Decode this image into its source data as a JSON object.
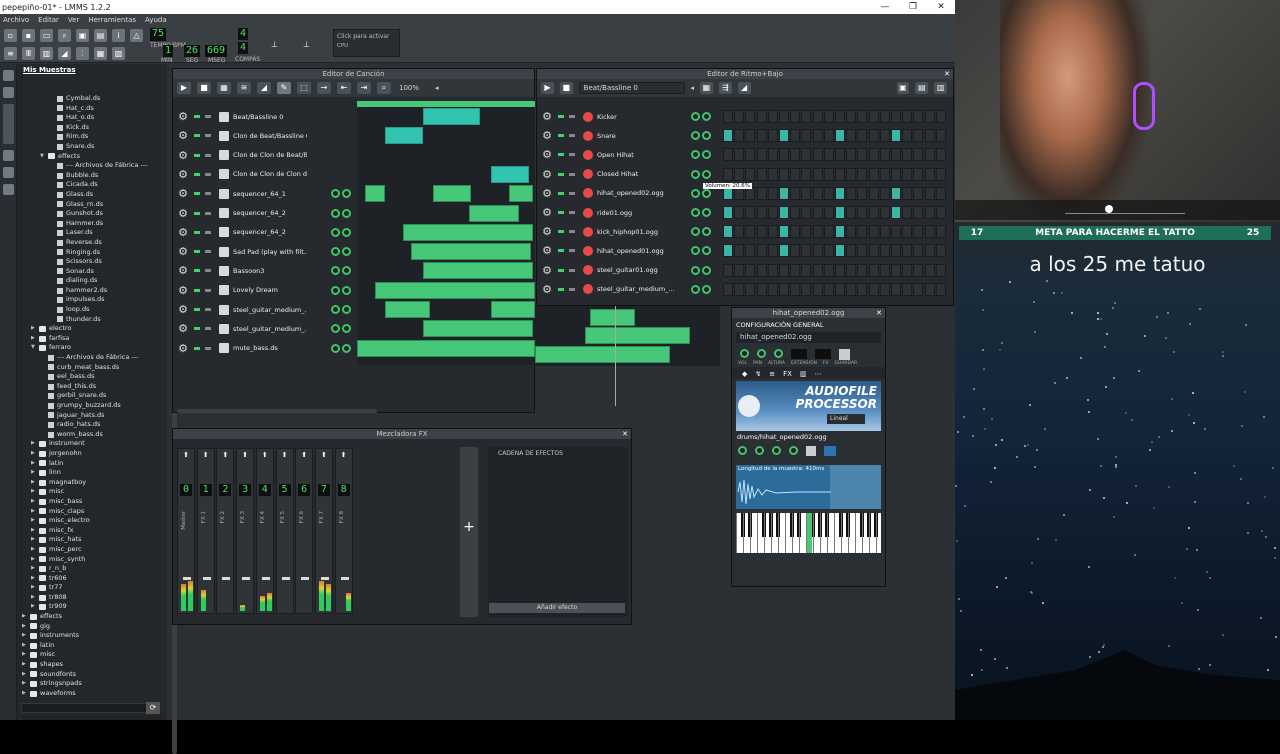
{
  "window": {
    "title": "pepepiño-01* - LMMS 1.2.2",
    "controls": [
      "—",
      "❐",
      "✕"
    ]
  },
  "menu": [
    "Archivo",
    "Editar",
    "Ver",
    "Herramientas",
    "Ayuda"
  ],
  "toolbar": {
    "tempo": "75",
    "tempo_label": "TEMPO/BPM",
    "time_min": "1",
    "time_sec": "26",
    "time_msec": "669",
    "time_labels": [
      "MIN",
      "SEG",
      "MSEG"
    ],
    "sig_top": "4",
    "sig_bottom": "4",
    "sig_label": "COMPÁS",
    "cpu_hint": "Click para activar",
    "cpu_label": "CPU"
  },
  "sidebar": {
    "title": "Mis Muestras",
    "items": [
      {
        "t": "Cymbal.ds",
        "k": "file",
        "d": 4
      },
      {
        "t": "Hat_c.ds",
        "k": "file",
        "d": 4
      },
      {
        "t": "Hat_o.ds",
        "k": "file",
        "d": 4
      },
      {
        "t": "Kick.ds",
        "k": "file",
        "d": 4
      },
      {
        "t": "Rim.ds",
        "k": "file",
        "d": 4
      },
      {
        "t": "Snare.ds",
        "k": "file",
        "d": 4
      },
      {
        "t": "effects",
        "k": "folder",
        "d": 3,
        "open": true
      },
      {
        "t": "--- Archivos de Fábrica ---",
        "k": "file",
        "d": 4
      },
      {
        "t": "Bubble.ds",
        "k": "file",
        "d": 4
      },
      {
        "t": "Cicada.ds",
        "k": "file",
        "d": 4
      },
      {
        "t": "Glass.ds",
        "k": "file",
        "d": 4
      },
      {
        "t": "Glass_rn.ds",
        "k": "file",
        "d": 4
      },
      {
        "t": "Gunshot.ds",
        "k": "file",
        "d": 4
      },
      {
        "t": "Hammer.ds",
        "k": "file",
        "d": 4
      },
      {
        "t": "Laser.ds",
        "k": "file",
        "d": 4
      },
      {
        "t": "Reverse.ds",
        "k": "file",
        "d": 4
      },
      {
        "t": "Ringing.ds",
        "k": "file",
        "d": 4
      },
      {
        "t": "Scissors.ds",
        "k": "file",
        "d": 4
      },
      {
        "t": "Sonar.ds",
        "k": "file",
        "d": 4
      },
      {
        "t": "dialing.ds",
        "k": "file",
        "d": 4
      },
      {
        "t": "hammer2.ds",
        "k": "file",
        "d": 4
      },
      {
        "t": "impulses.ds",
        "k": "file",
        "d": 4
      },
      {
        "t": "loop.ds",
        "k": "file",
        "d": 4
      },
      {
        "t": "thunder.ds",
        "k": "file",
        "d": 4
      },
      {
        "t": "electro",
        "k": "folder",
        "d": 2
      },
      {
        "t": "farfisa",
        "k": "folder",
        "d": 2
      },
      {
        "t": "ferraro",
        "k": "folder",
        "d": 2,
        "open": true
      },
      {
        "t": "--- Archivos de Fábrica ---",
        "k": "file",
        "d": 3
      },
      {
        "t": "curb_meat_bass.ds",
        "k": "file",
        "d": 3
      },
      {
        "t": "eel_bass.ds",
        "k": "file",
        "d": 3
      },
      {
        "t": "feed_this.ds",
        "k": "file",
        "d": 3
      },
      {
        "t": "gerbil_snare.ds",
        "k": "file",
        "d": 3
      },
      {
        "t": "grumpy_buzzard.ds",
        "k": "file",
        "d": 3
      },
      {
        "t": "jaguar_hats.ds",
        "k": "file",
        "d": 3
      },
      {
        "t": "radio_hats.ds",
        "k": "file",
        "d": 3
      },
      {
        "t": "worm_bass.ds",
        "k": "file",
        "d": 3
      },
      {
        "t": "instrument",
        "k": "folder",
        "d": 2
      },
      {
        "t": "jorgenohn",
        "k": "folder",
        "d": 2
      },
      {
        "t": "latin",
        "k": "folder",
        "d": 2
      },
      {
        "t": "linn",
        "k": "folder",
        "d": 2
      },
      {
        "t": "magnatboy",
        "k": "folder",
        "d": 2
      },
      {
        "t": "misc",
        "k": "folder",
        "d": 2
      },
      {
        "t": "misc_bass",
        "k": "folder",
        "d": 2
      },
      {
        "t": "misc_claps",
        "k": "folder",
        "d": 2
      },
      {
        "t": "misc_electro",
        "k": "folder",
        "d": 2
      },
      {
        "t": "misc_fx",
        "k": "folder",
        "d": 2
      },
      {
        "t": "misc_hats",
        "k": "folder",
        "d": 2
      },
      {
        "t": "misc_perc",
        "k": "folder",
        "d": 2
      },
      {
        "t": "misc_synth",
        "k": "folder",
        "d": 2
      },
      {
        "t": "r_n_b",
        "k": "folder",
        "d": 2
      },
      {
        "t": "tr606",
        "k": "folder",
        "d": 2
      },
      {
        "t": "tr77",
        "k": "folder",
        "d": 2
      },
      {
        "t": "tr808",
        "k": "folder",
        "d": 2
      },
      {
        "t": "tr909",
        "k": "folder",
        "d": 2
      },
      {
        "t": "effects",
        "k": "folder",
        "d": 1
      },
      {
        "t": "gig",
        "k": "folder",
        "d": 1
      },
      {
        "t": "instruments",
        "k": "folder",
        "d": 1
      },
      {
        "t": "latin",
        "k": "folder",
        "d": 1
      },
      {
        "t": "misc",
        "k": "folder",
        "d": 1
      },
      {
        "t": "shapes",
        "k": "folder",
        "d": 1
      },
      {
        "t": "soundfonts",
        "k": "folder",
        "d": 1
      },
      {
        "t": "stringsnpads",
        "k": "folder",
        "d": 1
      },
      {
        "t": "waveforms",
        "k": "folder",
        "d": 1
      }
    ]
  },
  "song_editor": {
    "title": "Editor de Canción",
    "zoom": "100%",
    "tracks": [
      {
        "name": "Beat/Bassline 0",
        "type": "bb",
        "knobs": false
      },
      {
        "name": "Clon de Beat/Bassline 0",
        "type": "bb",
        "knobs": false
      },
      {
        "name": "Clon de Clon de Beat/B...",
        "type": "bb",
        "knobs": false
      },
      {
        "name": "Clon de Clon de Clon d...",
        "type": "bb",
        "knobs": false
      },
      {
        "name": "sequencer_64_1",
        "type": "inst",
        "knobs": true
      },
      {
        "name": "sequencer_64_2",
        "type": "inst",
        "knobs": true
      },
      {
        "name": "sequencer_64_2",
        "type": "inst",
        "knobs": true
      },
      {
        "name": "Sad Pad (play with filt...",
        "type": "inst",
        "knobs": true
      },
      {
        "name": "Bassoon3",
        "type": "inst",
        "knobs": true
      },
      {
        "name": "Lovely Dream",
        "type": "inst",
        "knobs": true
      },
      {
        "name": "steel_guitar_medium_...",
        "type": "inst",
        "knobs": true
      },
      {
        "name": "steel_guitar_medium_...",
        "type": "inst",
        "knobs": true
      },
      {
        "name": "mute_bass.ds",
        "type": "inst",
        "knobs": true
      }
    ],
    "knob_label": "VOL PAN"
  },
  "beat_editor": {
    "title": "Editor de Ritmo+Bajo",
    "pattern": "Beat/Bassline 0",
    "tracks": [
      {
        "name": "Kicker",
        "steps": [
          0,
          0,
          0,
          0,
          0,
          0,
          0,
          0,
          0,
          0,
          0,
          0,
          0,
          0,
          0,
          0,
          0,
          0,
          0,
          0
        ]
      },
      {
        "name": "Snare",
        "steps": [
          1,
          0,
          0,
          0,
          0,
          1,
          0,
          0,
          0,
          0,
          1,
          0,
          0,
          0,
          0,
          1,
          0,
          0,
          0,
          0
        ]
      },
      {
        "name": "Open Hihat",
        "steps": [
          0,
          0,
          0,
          0,
          0,
          0,
          0,
          0,
          0,
          0,
          0,
          0,
          0,
          0,
          0,
          0,
          0,
          0,
          0,
          0
        ]
      },
      {
        "name": "Closed Hihat",
        "steps": [
          0,
          0,
          0,
          0,
          0,
          0,
          0,
          0,
          0,
          0,
          0,
          0,
          0,
          0,
          0,
          0,
          0,
          0,
          0,
          0
        ]
      },
      {
        "name": "hihat_opened02.ogg",
        "steps": [
          1,
          0,
          0,
          0,
          0,
          1,
          0,
          0,
          0,
          0,
          1,
          0,
          0,
          0,
          0,
          1,
          0,
          0,
          0,
          0
        ]
      },
      {
        "name": "ride01.ogg",
        "steps": [
          1,
          0,
          0,
          0,
          0,
          1,
          0,
          0,
          0,
          0,
          1,
          0,
          0,
          0,
          0,
          1,
          0,
          0,
          0,
          0
        ]
      },
      {
        "name": "kick_hiphop01.ogg",
        "steps": [
          1,
          0,
          0,
          0,
          0,
          1,
          0,
          0,
          0,
          0,
          1,
          0,
          0,
          0,
          0,
          0,
          0,
          0,
          0,
          0
        ]
      },
      {
        "name": "hihat_opened01.ogg",
        "steps": [
          1,
          0,
          0,
          0,
          0,
          1,
          0,
          0,
          0,
          0,
          1,
          0,
          0,
          0,
          0,
          0,
          0,
          0,
          0,
          0
        ]
      },
      {
        "name": "steel_guitar01.ogg",
        "steps": [
          0,
          0,
          0,
          0,
          0,
          0,
          0,
          0,
          0,
          0,
          0,
          0,
          0,
          0,
          0,
          0,
          0,
          0,
          0,
          0
        ]
      },
      {
        "name": "steel_guitar_medium_...",
        "steps": [
          0,
          0,
          0,
          0,
          0,
          0,
          0,
          0,
          0,
          0,
          0,
          0,
          0,
          0,
          0,
          0,
          0,
          0,
          0,
          0
        ]
      }
    ],
    "tooltip": "Volumen: 20.6%"
  },
  "mixer": {
    "title": "Mezcladora FX",
    "channels": [
      {
        "num": "0",
        "label": "Master"
      },
      {
        "num": "1",
        "label": "FX 1"
      },
      {
        "num": "2",
        "label": "FX 2"
      },
      {
        "num": "3",
        "label": "FX 3"
      },
      {
        "num": "4",
        "label": "FX 4"
      },
      {
        "num": "5",
        "label": "FX 5"
      },
      {
        "num": "6",
        "label": "FX 6"
      },
      {
        "num": "7",
        "label": "FX 7"
      },
      {
        "num": "8",
        "label": "FX 8"
      }
    ],
    "add_channel": "+",
    "effects_chain": "CADENA DE EFECTOS",
    "add_effect": "Añadir efecto"
  },
  "instrument": {
    "title": "hihat_opened02.ogg",
    "section": "CONFIGURACIÓN GENERAL",
    "name": "hihat_opened02.ogg",
    "knob_labels": [
      "VOL",
      "PAN",
      "ALTURA",
      "EXTENSIÓN",
      "FX",
      "GUARDAR"
    ],
    "plugin_title_1": "AUDIOFILE",
    "plugin_title_2": "PROCESSOR",
    "interp": "Lineal",
    "file": "drums/hihat_opened02.ogg",
    "sample_length": "Longitud de la muestra: 410ms"
  },
  "stream": {
    "goal_left": "17",
    "goal_text": "META PARA HACERME EL TATTO",
    "goal_right": "25",
    "caption": "a los 25 me tatuo"
  },
  "colors": {
    "accent": "#46c878",
    "teal": "#33c4b0",
    "goal": "#1f6e57"
  }
}
